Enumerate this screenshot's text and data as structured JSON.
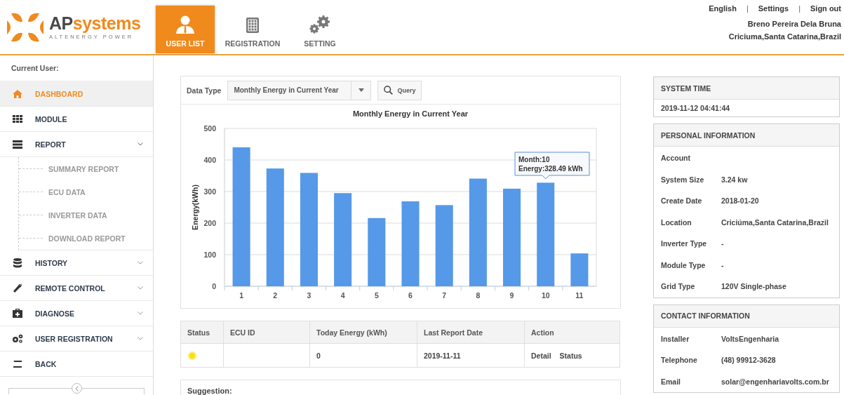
{
  "logo": {
    "brand_dark": "AP",
    "brand_light": "systems",
    "tagline": "ALTENERGY POWER"
  },
  "nav_tabs": [
    {
      "label": "USER LIST",
      "selected": true
    },
    {
      "label": "REGISTRATION",
      "selected": false
    },
    {
      "label": "SETTING",
      "selected": false
    }
  ],
  "top_links": [
    {
      "kind": "link",
      "text": "English"
    },
    {
      "kind": "separator",
      "text": "|"
    },
    {
      "kind": "link",
      "text": "Settings"
    },
    {
      "kind": "separator",
      "text": "|"
    },
    {
      "kind": "link",
      "text": "Sign out"
    }
  ],
  "user": {
    "name": "Breno Pereira Dela Bruna",
    "location": "Criciuma,Santa Catarina,Brazil"
  },
  "sidebar": {
    "current_user_label": "Current User:",
    "items": [
      {
        "label": "DASHBOARD",
        "selected": true
      },
      {
        "label": "MODULE",
        "selected": false
      },
      {
        "label": "REPORT",
        "selected": false,
        "expanded": true,
        "children": [
          {
            "label": "SUMMARY REPORT"
          },
          {
            "label": "ECU DATA"
          },
          {
            "label": "INVERTER DATA"
          },
          {
            "label": "DOWNLOAD REPORT"
          }
        ]
      },
      {
        "label": "HISTORY",
        "selected": false,
        "expanded": false
      },
      {
        "label": "REMOTE CONTROL",
        "selected": false,
        "expanded": false
      },
      {
        "label": "DIAGNOSE",
        "selected": false,
        "expanded": false
      },
      {
        "label": "USER REGISTRATION",
        "selected": false,
        "expanded": false
      },
      {
        "label": "BACK",
        "selected": false
      }
    ]
  },
  "filter": {
    "label": "Data Type",
    "value": "Monthly Energy in Current Year",
    "button": "Query"
  },
  "chart": {
    "tooltip": [
      "Month:10",
      "Energy:328.49 kWh"
    ],
    "chart_data": {
      "type": "bar",
      "title": "Monthly Energy in Current Year",
      "ylabel": "Energy(kWh)",
      "categories": [
        "1",
        "2",
        "3",
        "4",
        "5",
        "6",
        "7",
        "8",
        "9",
        "10",
        "11"
      ],
      "series": [
        {
          "color": "#5599e8",
          "values": [
            440,
            373,
            359,
            295,
            216,
            269,
            257,
            341,
            309,
            328,
            104
          ]
        }
      ],
      "ylim": [
        0,
        500
      ],
      "yticks": [
        0,
        100,
        200,
        300,
        400,
        500
      ],
      "grid": true
    }
  },
  "ecu_table": {
    "columns": [
      "Status",
      "ECU ID",
      "Today Energy (kWh)",
      "Last Report Date",
      "Action"
    ],
    "rows": [
      {
        "color": "#f7e11b",
        "today_energy": "0",
        "last_report_date": "2019-11-11",
        "actions": [
          "Detail",
          "Status"
        ]
      }
    ]
  },
  "suggestion": {
    "title": "Suggestion:"
  },
  "system_time": {
    "title": "SYSTEM TIME",
    "value": "2019-11-12 04:41:44"
  },
  "personal_information": {
    "title": "PERSONAL INFORMATION",
    "fields": [
      {
        "label": "Account"
      },
      {
        "label": "System Size",
        "value": "3.24 kw"
      },
      {
        "label": "Create Date",
        "value": "2018-01-20"
      },
      {
        "label": "Location",
        "value": "Criciúma,Santa Catarina,Brazil"
      },
      {
        "label": "Inverter Type",
        "value": "-"
      },
      {
        "label": "Module Type",
        "value": "-"
      },
      {
        "label": "Grid Type",
        "value": "120V Single-phase"
      }
    ]
  },
  "contact_information": {
    "title": "CONTACT INFORMATION",
    "fields": [
      {
        "label": "Installer",
        "value": "VoltsEngenharia"
      },
      {
        "label": "Telephone",
        "value": "(48) 99912-3628"
      },
      {
        "label": "Email",
        "value": "solar@engenhariavolts.com.br"
      }
    ]
  }
}
